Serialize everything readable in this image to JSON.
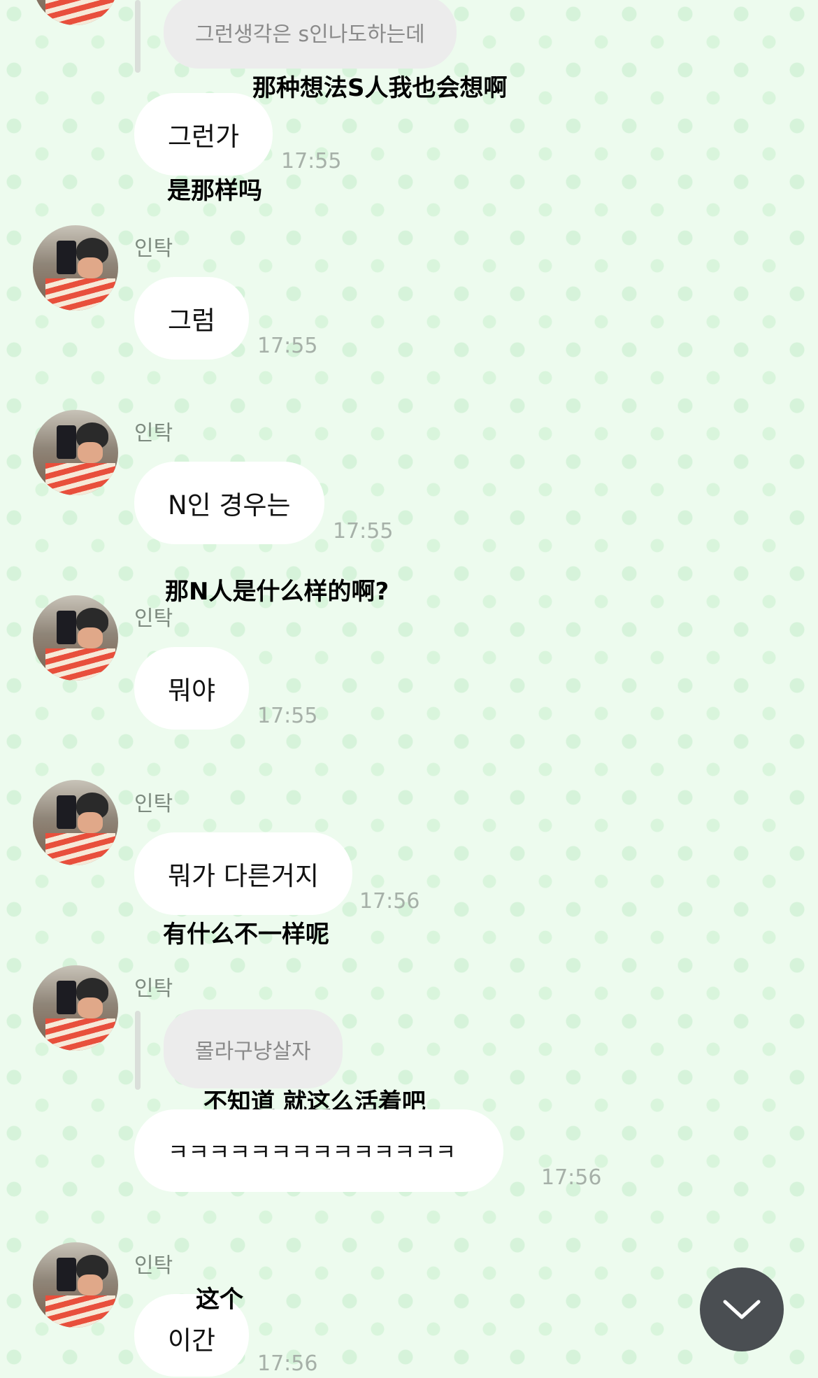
{
  "messages": [
    {
      "reply_preview": "그런생각은 s인나도하는데",
      "translation": "那种想法S人我也会想啊",
      "text": "그런가",
      "time": "17:55",
      "translation2": "是那样吗"
    },
    {
      "sender": "인탁",
      "text": "그럼",
      "time": "17:55"
    },
    {
      "sender": "인탁",
      "text": "N인 경우는",
      "time": "17:55",
      "translation": "那N人是什么样的啊?"
    },
    {
      "sender": "인탁",
      "text": "뭐야",
      "time": "17:55"
    },
    {
      "sender": "인탁",
      "text": "뭐가 다른거지",
      "time": "17:56",
      "translation": "有什么不一样呢"
    },
    {
      "sender": "인탁",
      "reply_preview": "몰라구냥살자",
      "translation": "不知道 就这么活着吧",
      "text": "ㅋㅋㅋㅋㅋㅋㅋㅋㅋㅋㅋㅋㅋㅋ",
      "time": "17:56"
    },
    {
      "sender": "인탁",
      "translation": "这个",
      "text": "이간",
      "time": "17:56"
    }
  ],
  "scroll_button": {
    "icon": "chevron-down-icon"
  }
}
